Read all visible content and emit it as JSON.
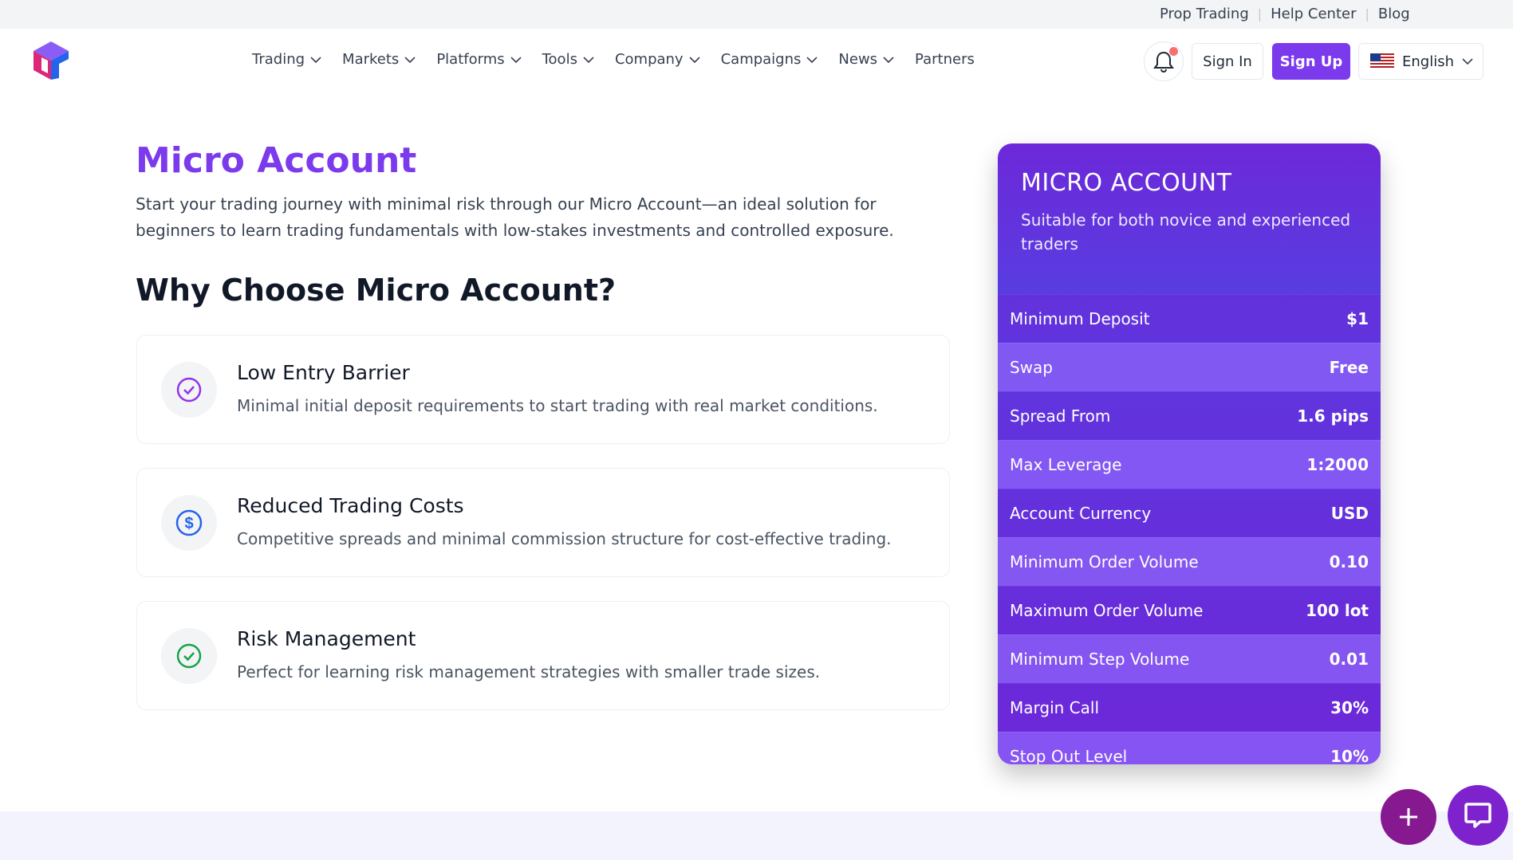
{
  "topbar": {
    "links": [
      "Prop Trading",
      "Help Center",
      "Blog"
    ]
  },
  "nav": {
    "logo_icon": "brand-logo-icon",
    "menu": [
      "Trading",
      "Markets",
      "Platforms",
      "Tools",
      "Company",
      "Campaigns",
      "News",
      "Partners"
    ],
    "sign_in": "Sign In",
    "sign_up": "Sign Up",
    "language": "English"
  },
  "hero": {
    "title": "Micro Account",
    "intro": "Start your trading journey with minimal risk through our Micro Account—an ideal solution for beginners to learn trading fundamentals with low-stakes investments and controlled exposure."
  },
  "why": {
    "title": "Why Choose Micro Account?",
    "features": [
      {
        "title": "Low Entry Barrier",
        "desc": "Minimal initial deposit requirements to start trading with real market conditions.",
        "icon": "check-circle-icon",
        "color": "#9333ea"
      },
      {
        "title": "Reduced Trading Costs",
        "desc": "Competitive spreads and minimal commission structure for cost-effective trading.",
        "icon": "dollar-circle-icon",
        "color": "#2563eb"
      },
      {
        "title": "Risk Management",
        "desc": "Perfect for learning risk management strategies with smaller trade sizes.",
        "icon": "check-circle-icon",
        "color": "#16a34a"
      }
    ]
  },
  "card": {
    "title": "MICRO ACCOUNT",
    "subtitle": "Suitable for both novice and experienced traders",
    "rows": [
      {
        "label": "Minimum Deposit",
        "value": "$1"
      },
      {
        "label": "Swap",
        "value": "Free"
      },
      {
        "label": "Spread From",
        "value": "1.6 pips"
      },
      {
        "label": "Max Leverage",
        "value": "1:2000"
      },
      {
        "label": "Account Currency",
        "value": "USD"
      },
      {
        "label": "Minimum Order Volume",
        "value": "0.10"
      },
      {
        "label": "Maximum Order Volume",
        "value": "100 lot"
      },
      {
        "label": "Minimum Step Volume",
        "value": "0.01"
      },
      {
        "label": "Margin Call",
        "value": "30%"
      },
      {
        "label": "Stop Out Level",
        "value": "10%"
      }
    ]
  },
  "colors": {
    "accent": "#7c3aed",
    "card_bg": "#5b21b6"
  }
}
